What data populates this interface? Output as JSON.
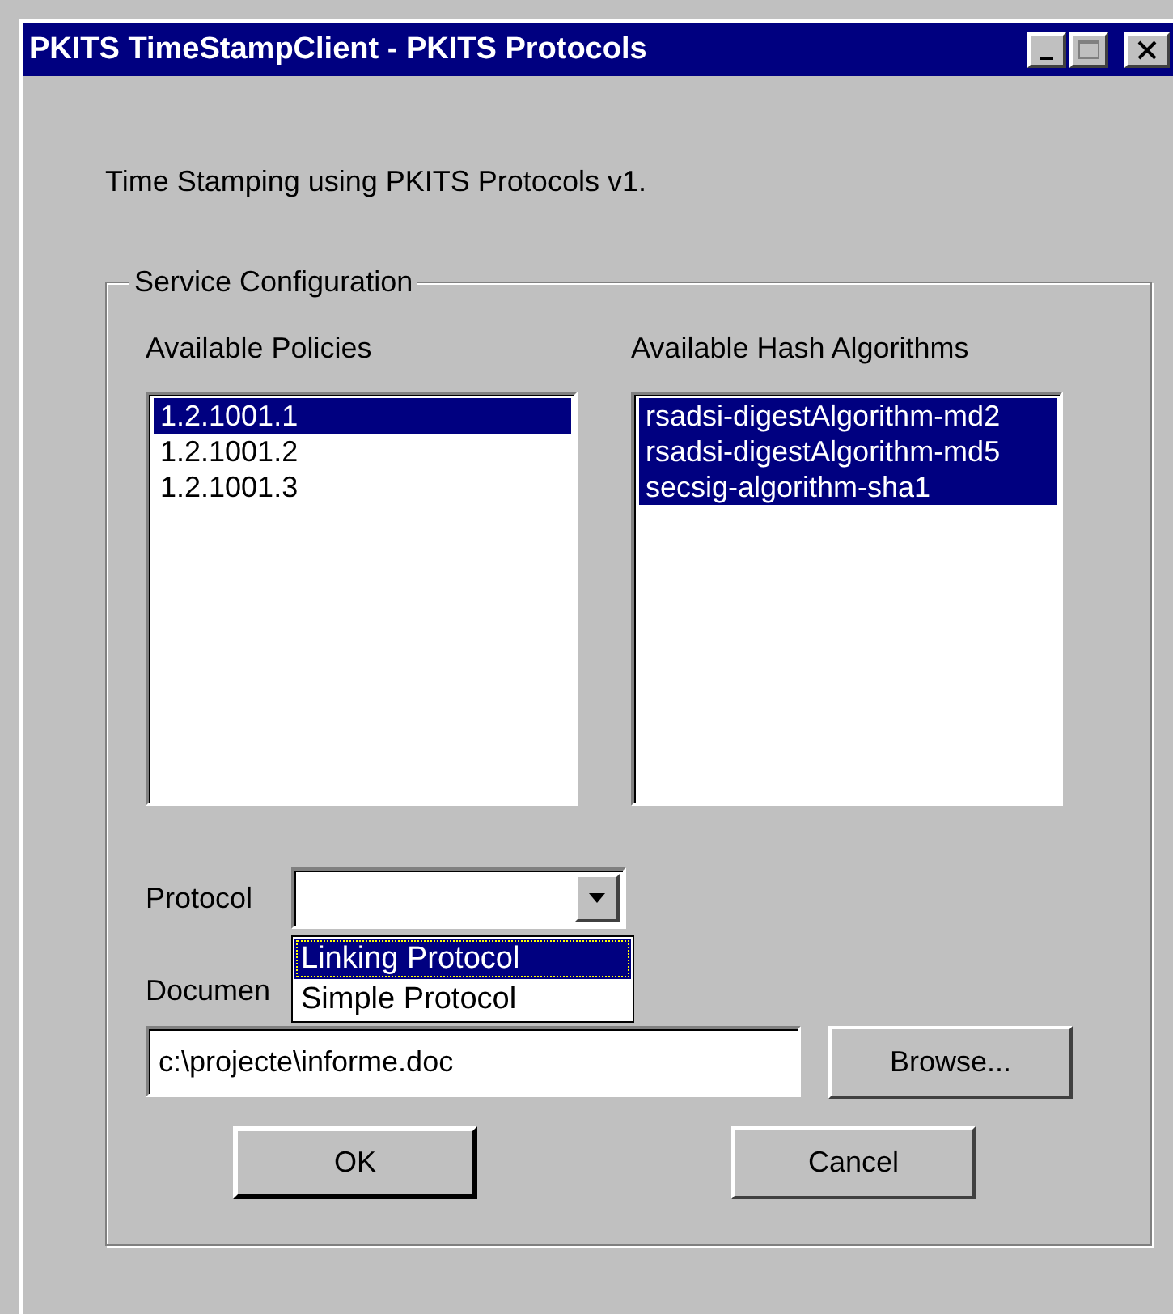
{
  "window": {
    "title": "PKITS TimeStampClient - PKITS Protocols"
  },
  "intro": "Time Stamping using PKITS Protocols v1.",
  "group": {
    "title": "Service Configuration"
  },
  "policies": {
    "label": "Available Policies",
    "items": [
      {
        "text": "1.2.1001.1",
        "selected": true
      },
      {
        "text": "1.2.1001.2",
        "selected": false
      },
      {
        "text": "1.2.1001.3",
        "selected": false
      }
    ]
  },
  "hash_algorithms": {
    "label": "Available Hash Algorithms",
    "items": [
      {
        "text": "rsadsi-digestAlgorithm-md2",
        "selected": true
      },
      {
        "text": "rsadsi-digestAlgorithm-md5",
        "selected": true
      },
      {
        "text": "secsig-algorithm-sha1",
        "selected": true
      }
    ]
  },
  "protocol": {
    "label": "Protocol",
    "expanded": true,
    "options": [
      {
        "text": "Linking Protocol",
        "selected": true
      },
      {
        "text": "Simple Protocol",
        "selected": false
      }
    ]
  },
  "document": {
    "label": "Documen",
    "value": "c:\\projecte\\informe.doc"
  },
  "browse_button": "Browse...",
  "buttons": [
    {
      "label": "OK",
      "default": true
    },
    {
      "label": "Cancel",
      "default": false
    }
  ]
}
